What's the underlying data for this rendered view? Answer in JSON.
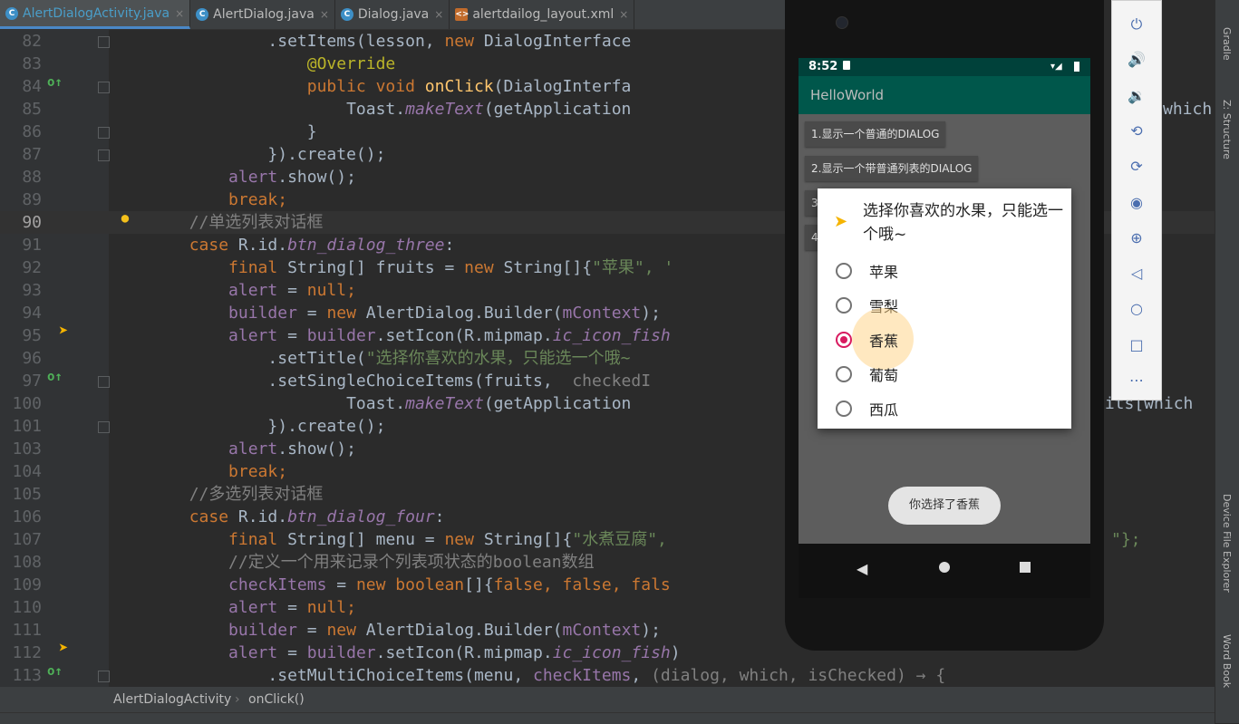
{
  "tabs": [
    {
      "label": "AlertDialogActivity.java",
      "icon": "java-class-icon"
    },
    {
      "label": "AlertDialog.java",
      "icon": "java-class-icon"
    },
    {
      "label": "Dialog.java",
      "icon": "java-class-icon"
    },
    {
      "label": "alertdailog_layout.xml",
      "icon": "xml-file-icon"
    }
  ],
  "code_lines": [
    {
      "num": "82",
      "tokens": [
        [
          "p",
          "                .setItems(lesson, "
        ],
        [
          "kw",
          "new "
        ],
        [
          "p",
          "DialogInterface"
        ]
      ]
    },
    {
      "num": "83",
      "tokens": [
        [
          "an",
          "                    @Override"
        ]
      ]
    },
    {
      "num": "84",
      "tokens": [
        [
          "kw",
          "                    public void "
        ],
        [
          "mt",
          "onClick"
        ],
        [
          "p",
          "(DialogInterfa"
        ]
      ]
    },
    {
      "num": "85",
      "tokens": [
        [
          "p",
          "                        Toast."
        ],
        [
          "it",
          "makeText"
        ],
        [
          "p",
          "(getApplication"
        ]
      ]
    },
    {
      "num": "86",
      "tokens": [
        [
          "p",
          "                    }"
        ]
      ]
    },
    {
      "num": "87",
      "tokens": [
        [
          "p",
          "                }).create();"
        ]
      ]
    },
    {
      "num": "88",
      "tokens": [
        [
          "fl",
          "            alert"
        ],
        [
          "p",
          ".show();"
        ]
      ]
    },
    {
      "num": "89",
      "tokens": [
        [
          "kw",
          "            break;"
        ]
      ]
    },
    {
      "num": "90",
      "tokens": [
        [
          "cm",
          "        //单选列表对话框"
        ]
      ]
    },
    {
      "num": "91",
      "tokens": [
        [
          "kw",
          "        case "
        ],
        [
          "p",
          "R.id."
        ],
        [
          "it",
          "btn_dialog_three"
        ],
        [
          "p",
          ":"
        ]
      ]
    },
    {
      "num": "92",
      "tokens": [
        [
          "kw",
          "            final "
        ],
        [
          "p",
          "String[] fruits = "
        ],
        [
          "kw",
          "new "
        ],
        [
          "p",
          "String[]{"
        ],
        [
          "st",
          "\"苹果\", '"
        ]
      ]
    },
    {
      "num": "93",
      "tokens": [
        [
          "fl",
          "            alert "
        ],
        [
          "p",
          "= "
        ],
        [
          "kw",
          "null;"
        ]
      ]
    },
    {
      "num": "94",
      "tokens": [
        [
          "fl",
          "            builder "
        ],
        [
          "p",
          "= "
        ],
        [
          "kw",
          "new "
        ],
        [
          "p",
          "AlertDialog.Builder("
        ],
        [
          "fl",
          "mContext"
        ],
        [
          "p",
          ");"
        ]
      ]
    },
    {
      "num": "95",
      "tokens": [
        [
          "fl",
          "            alert "
        ],
        [
          "p",
          "= "
        ],
        [
          "fl",
          "builder"
        ],
        [
          "p",
          ".setIcon(R.mipmap."
        ],
        [
          "it",
          "ic_icon_fish"
        ]
      ]
    },
    {
      "num": "96",
      "tokens": [
        [
          "p",
          "                .setTitle("
        ],
        [
          "st",
          "\"选择你喜欢的水果，只能选一个哦~"
        ]
      ]
    },
    {
      "num": "97",
      "tokens": [
        [
          "p",
          "                .setSingleChoiceItems(fruits, "
        ],
        [
          "cm",
          " checkedI"
        ]
      ]
    },
    {
      "num": "100",
      "tokens": [
        [
          "p",
          "                        Toast."
        ],
        [
          "it",
          "makeText"
        ],
        [
          "p",
          "(getApplication"
        ]
      ]
    },
    {
      "num": "101",
      "tokens": [
        [
          "p",
          "                }).create();"
        ]
      ]
    },
    {
      "num": "103",
      "tokens": [
        [
          "fl",
          "            alert"
        ],
        [
          "p",
          ".show();"
        ]
      ]
    },
    {
      "num": "104",
      "tokens": [
        [
          "kw",
          "            break;"
        ]
      ]
    },
    {
      "num": "105",
      "tokens": [
        [
          "cm",
          "        //多选列表对话框"
        ]
      ]
    },
    {
      "num": "106",
      "tokens": [
        [
          "kw",
          "        case "
        ],
        [
          "p",
          "R.id."
        ],
        [
          "it",
          "btn_dialog_four"
        ],
        [
          "p",
          ":"
        ]
      ]
    },
    {
      "num": "107",
      "tokens": [
        [
          "kw",
          "            final "
        ],
        [
          "p",
          "String[] menu = "
        ],
        [
          "kw",
          "new "
        ],
        [
          "p",
          "String[]{"
        ],
        [
          "st",
          "\"水煮豆腐\", "
        ]
      ]
    },
    {
      "num": "108",
      "tokens": [
        [
          "cm",
          "            //定义一个用来记录个列表项状态的boolean数组"
        ]
      ]
    },
    {
      "num": "109",
      "tokens": [
        [
          "fl",
          "            checkItems "
        ],
        [
          "p",
          "= "
        ],
        [
          "kw",
          "new boolean"
        ],
        [
          "p",
          "[]{"
        ],
        [
          "kw",
          "false, false, fals"
        ]
      ]
    },
    {
      "num": "110",
      "tokens": [
        [
          "fl",
          "            alert "
        ],
        [
          "p",
          "= "
        ],
        [
          "kw",
          "null;"
        ]
      ]
    },
    {
      "num": "111",
      "tokens": [
        [
          "fl",
          "            builder "
        ],
        [
          "p",
          "= "
        ],
        [
          "kw",
          "new "
        ],
        [
          "p",
          "AlertDialog.Builder("
        ],
        [
          "fl",
          "mContext"
        ],
        [
          "p",
          ");"
        ]
      ]
    },
    {
      "num": "112",
      "tokens": [
        [
          "fl",
          "            alert "
        ],
        [
          "p",
          "= "
        ],
        [
          "fl",
          "builder"
        ],
        [
          "p",
          ".setIcon(R.mipmap."
        ],
        [
          "it",
          "ic_icon_fish"
        ],
        [
          "p",
          ")"
        ]
      ]
    },
    {
      "num": "113",
      "tokens": [
        [
          "p",
          "                .setMultiChoiceItems(menu, "
        ],
        [
          "fl",
          "checkItems"
        ],
        [
          "p",
          ", "
        ],
        [
          "cm",
          "(dialog, which, isChecked) → {"
        ]
      ]
    }
  ],
  "code_overflow": {
    "line85_tail": "which",
    "line100_tail": "uits[which",
    "line107_tail": "\"};"
  },
  "current_line": "90",
  "breadcrumb": {
    "class": "AlertDialogActivity",
    "method": "onClick()"
  },
  "right_panel": [
    "Gradle",
    "Z: Structure",
    "Device File Explorer",
    "Word Book"
  ],
  "phone": {
    "time": "8:52",
    "app_title": "HelloWorld",
    "buttons": [
      "1.显示一个普通的DIALOG",
      "2.显示一个带普通列表的DIALOG",
      "3",
      "4"
    ],
    "dialog": {
      "title": "选择你喜欢的水果，只能选一个哦~",
      "options": [
        "苹果",
        "雪梨",
        "香蕉",
        "葡萄",
        "西瓜"
      ],
      "selected_index": 2
    },
    "toast": "你选择了香蕉"
  },
  "emulator_controls": [
    "power-icon",
    "volume-up-icon",
    "volume-down-icon",
    "rotate-left-icon",
    "rotate-right-icon",
    "camera-icon",
    "zoom-icon",
    "back-icon",
    "home-icon",
    "overview-icon",
    "more-icon"
  ]
}
